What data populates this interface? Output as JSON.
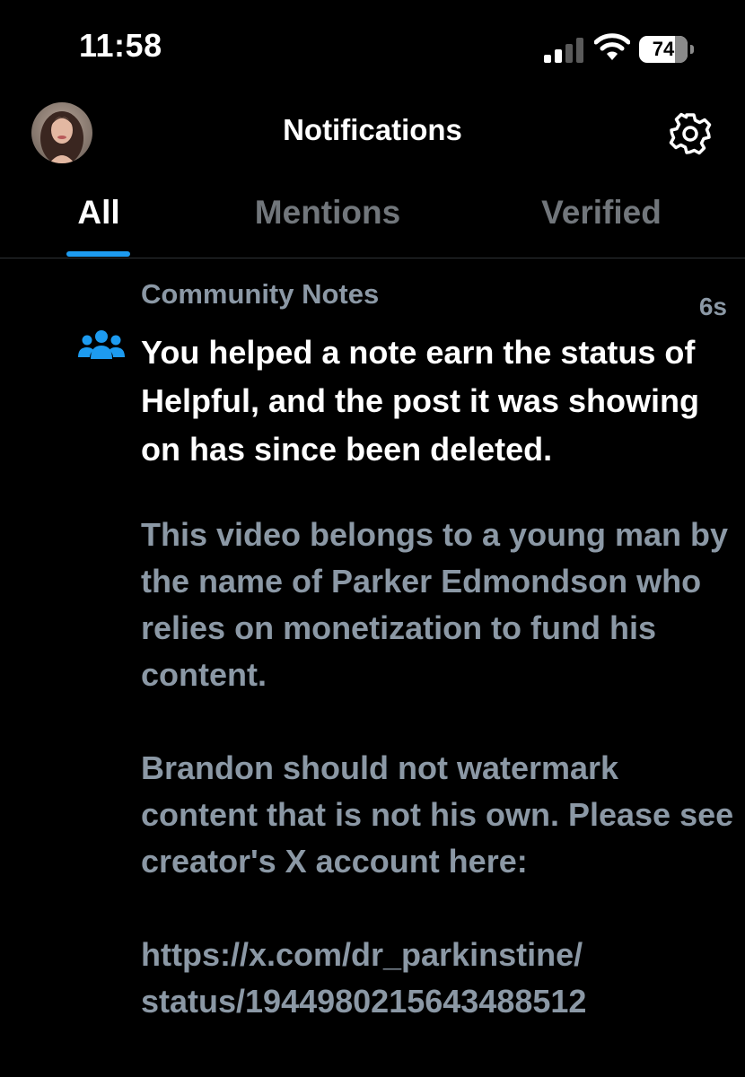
{
  "status_bar": {
    "time": "11:58",
    "battery_level": "74",
    "battery_fraction": 0.74,
    "signal_bars_active": 2,
    "icons": [
      "signal-icon",
      "wifi-icon",
      "battery-icon"
    ]
  },
  "header": {
    "title": "Notifications",
    "avatar_icon": "avatar",
    "settings_icon": "gear-icon"
  },
  "tabs": [
    {
      "label": "All",
      "active": true
    },
    {
      "label": "Mentions",
      "active": false
    },
    {
      "label": "Verified",
      "active": false
    }
  ],
  "notification": {
    "icon": "community-icon",
    "category": "Community Notes",
    "timestamp": "6s",
    "headline": "You helped a note earn the status of Helpful, and the post it was showing on has since been deleted.",
    "body": "This video belongs to a young man by the name of Parker Edmondson who relies on monetization to fund his content.\n\nBrandon should not watermark content that is not his own. Please see creator's X account here:\n\nhttps://x.com/dr_parkinstine/ status/1944980215643488512"
  },
  "colors": {
    "background": "#000000",
    "primary_text": "#ffffff",
    "secondary_text": "#8b98a5",
    "inactive_tab": "#71767b",
    "accent": "#1d9bf0",
    "community_icon": "#1d9bf0"
  }
}
